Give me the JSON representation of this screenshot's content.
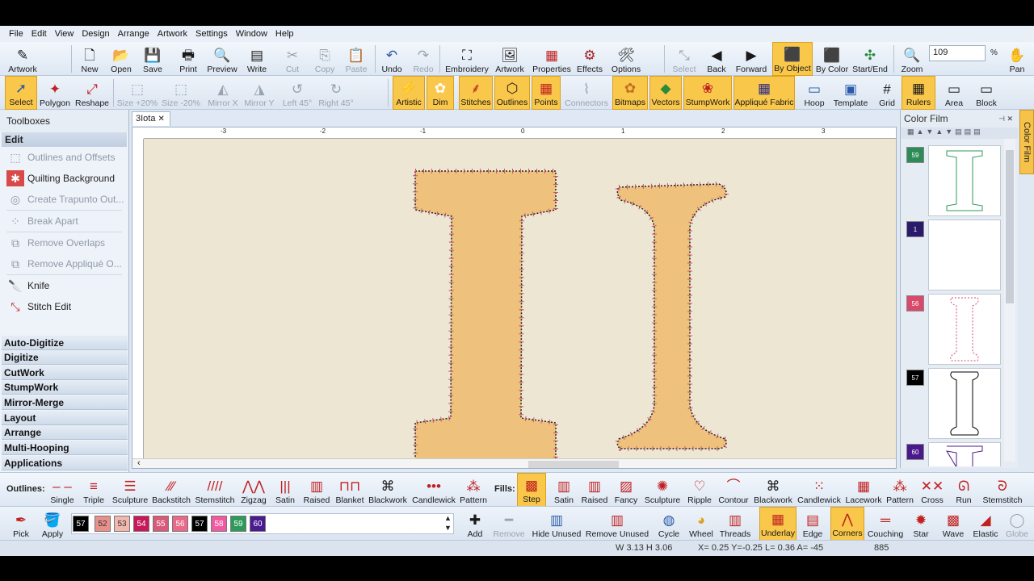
{
  "menu": [
    "File",
    "Edit",
    "View",
    "Design",
    "Arrange",
    "Artwork",
    "Settings",
    "Window",
    "Help"
  ],
  "toolbar1": {
    "artwork": "Artwork",
    "new": "New",
    "open": "Open",
    "save": "Save",
    "print": "Print",
    "preview": "Preview",
    "write": "Write",
    "cut": "Cut",
    "copy": "Copy",
    "paste": "Paste",
    "undo": "Undo",
    "redo": "Redo",
    "embroidery": "Embroidery",
    "artwork2": "Artwork",
    "properties": "Properties",
    "effects": "Effects",
    "options": "Options",
    "select": "Select",
    "back": "Back",
    "forward": "Forward",
    "by_object": "By Object",
    "by_color": "By Color",
    "start_end": "Start/End",
    "zoom": "Zoom",
    "zoom_value": "109",
    "zoom_unit": "%",
    "pan": "Pan"
  },
  "toolbar2": {
    "select": "Select",
    "polygon": "Polygon",
    "reshape": "Reshape",
    "size_plus": "Size +20%",
    "size_minus": "Size -20%",
    "mirror_x": "Mirror X",
    "mirror_y": "Mirror Y",
    "left45": "Left 45°",
    "right45": "Right 45°",
    "artistic": "Artistic",
    "dim": "Dim",
    "stitches": "Stitches",
    "outlines": "Outlines",
    "points": "Points",
    "connectors": "Connectors",
    "bitmaps": "Bitmaps",
    "vectors": "Vectors",
    "stumpwork": "StumpWork",
    "applique_fabric": "Appliqué Fabric",
    "hoop": "Hoop",
    "template": "Template",
    "grid": "Grid",
    "rulers": "Rulers",
    "area": "Area",
    "block": "Block"
  },
  "toolboxes": {
    "title": "Toolboxes",
    "edit_header": "Edit",
    "tools": [
      {
        "label": "Outlines and Offsets",
        "enabled": false
      },
      {
        "label": "Quilting Background",
        "enabled": true
      },
      {
        "label": "Create Trapunto Out...",
        "enabled": false
      },
      {
        "label": "Break Apart",
        "enabled": false
      },
      {
        "label": "Remove Overlaps",
        "enabled": false
      },
      {
        "label": "Remove Appliqué O...",
        "enabled": false
      },
      {
        "label": "Knife",
        "enabled": true
      },
      {
        "label": "Stitch Edit",
        "enabled": true
      }
    ],
    "sections": [
      "Auto-Digitize",
      "Digitize",
      "CutWork",
      "StumpWork",
      "Mirror-Merge",
      "Layout",
      "Arrange",
      "Multi-Hooping",
      "Applications"
    ]
  },
  "document": {
    "tab_label": "3Iota",
    "ruler_labels": [
      "-3",
      "-2",
      "-1",
      "0",
      "1",
      "2",
      "3"
    ]
  },
  "color_film": {
    "title": "Color Film",
    "side_tab": "Color Film",
    "items": [
      {
        "num": "59",
        "color": "#2e8b57"
      },
      {
        "num": "1",
        "color": "#2a1a6a"
      },
      {
        "num": "56",
        "color": "#d84a6a"
      },
      {
        "num": "57",
        "color": "#000000"
      },
      {
        "num": "60",
        "color": "#4b1a8a"
      }
    ]
  },
  "outlines_bar": {
    "label": "Outlines:",
    "items": [
      "Single",
      "Triple",
      "Sculpture",
      "Backstitch",
      "Stemstitch",
      "Zigzag",
      "Satin",
      "Raised",
      "Blanket",
      "Blackwork",
      "Candlewick",
      "Pattern"
    ],
    "fills_label": "Fills:",
    "fills": [
      "Step",
      "Satin",
      "Raised",
      "Fancy",
      "Sculpture",
      "Ripple",
      "Contour",
      "Blackwork",
      "Candlewick",
      "Lacework",
      "Pattern",
      "Cross",
      "Run",
      "Stemstitch"
    ]
  },
  "color_bar": {
    "pick": "Pick",
    "apply": "Apply",
    "swatches": [
      {
        "num": "57",
        "color": "#000000"
      },
      {
        "num": "52",
        "color": "#e8908a"
      },
      {
        "num": "53",
        "color": "#f2b8b0"
      },
      {
        "num": "54",
        "color": "#c8185a"
      },
      {
        "num": "55",
        "color": "#d85a78"
      },
      {
        "num": "56",
        "color": "#e86a88"
      },
      {
        "num": "57",
        "color": "#000000"
      },
      {
        "num": "58",
        "color": "#f05aa0"
      },
      {
        "num": "59",
        "color": "#2e9a5a"
      },
      {
        "num": "60",
        "color": "#4a1a90"
      }
    ],
    "add": "Add",
    "remove": "Remove",
    "hide_unused": "Hide Unused",
    "remove_unused": "Remove Unused",
    "cycle": "Cycle",
    "wheel": "Wheel",
    "threads": "Threads",
    "underlay": "Underlay",
    "edge": "Edge",
    "corners": "Corners",
    "couching": "Couching",
    "star": "Star",
    "wave": "Wave",
    "elastic": "Elastic",
    "globe": "Globe"
  },
  "status": {
    "size": "W 3.13 H 3.06",
    "coords": "X= 0.25 Y=-0.25 L= 0.36 A= -45",
    "count": "885"
  }
}
